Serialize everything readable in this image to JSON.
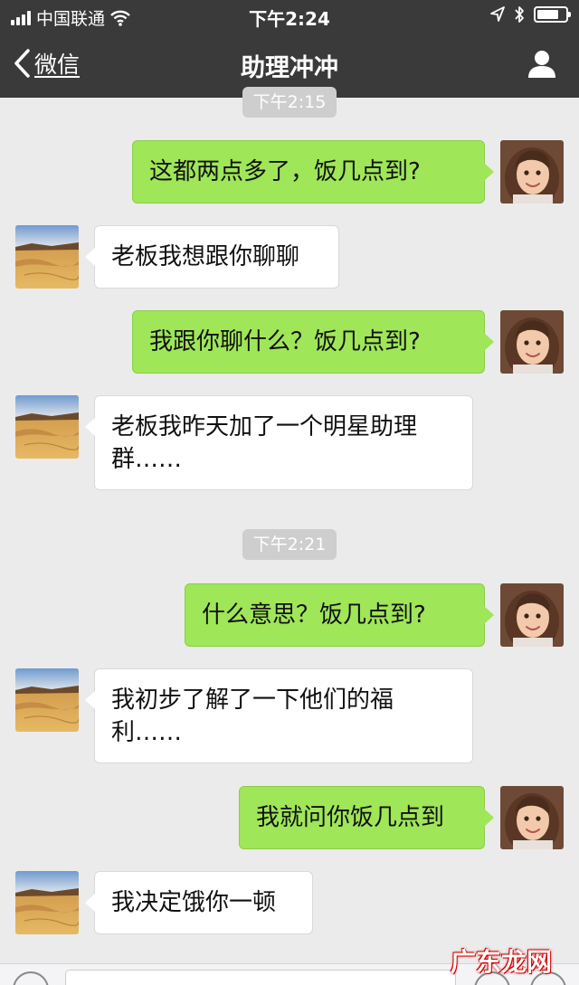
{
  "status_bar": {
    "carrier": "中国联通",
    "time": "下午2:24",
    "battery_level": 0.75
  },
  "nav": {
    "back_label": "微信",
    "title": "助理冲冲"
  },
  "messages": [
    {
      "type": "time",
      "text": "下午2:15"
    },
    {
      "type": "out",
      "text": "这都两点多了，饭几点到?"
    },
    {
      "type": "in",
      "text": "老板我想跟你聊聊"
    },
    {
      "type": "out",
      "text": "我跟你聊什么？饭几点到?"
    },
    {
      "type": "in",
      "text": "老板我昨天加了一个明星助理群……"
    },
    {
      "type": "time",
      "text": "下午2:21"
    },
    {
      "type": "out",
      "text": "什么意思？饭几点到?"
    },
    {
      "type": "in",
      "text": "我初步了解了一下他们的福利……"
    },
    {
      "type": "out",
      "text": "我就问你饭几点到"
    },
    {
      "type": "in",
      "text": "我决定饿你一顿"
    }
  ],
  "watermark": "广东龙网",
  "colors": {
    "header_bg": "#3a3a3b",
    "outgoing_bubble": "#9fe658",
    "incoming_bubble": "#ffffff",
    "chat_bg": "#ebebeb"
  },
  "icons": {
    "back": "chevron-left-icon",
    "profile": "person-icon",
    "wifi": "wifi-icon",
    "location": "location-arrow-icon",
    "bluetooth": "bluetooth-icon",
    "battery": "battery-icon"
  }
}
